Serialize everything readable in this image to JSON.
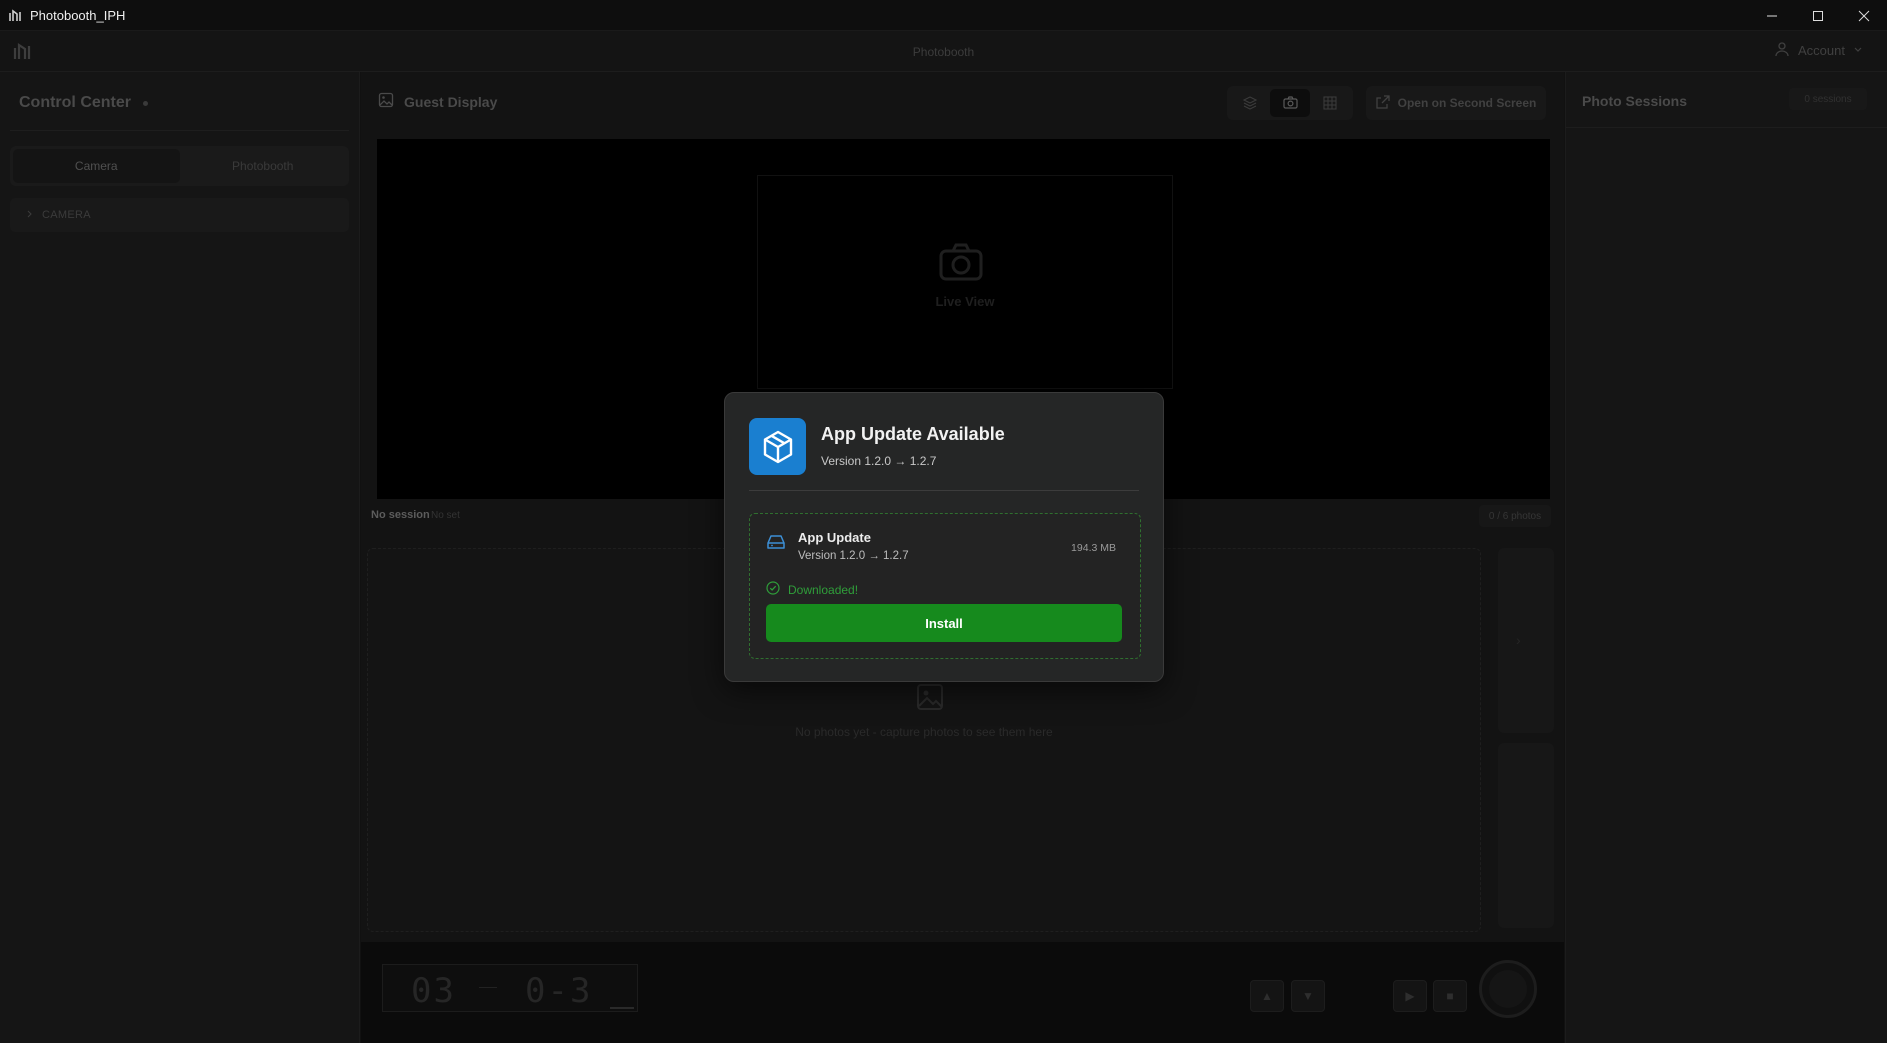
{
  "window": {
    "title": "Photobooth_IPH",
    "controls": [
      "minimize-icon",
      "maximize-icon",
      "close-icon"
    ]
  },
  "header": {
    "center_title": "Photobooth",
    "account_label": "Account"
  },
  "left_panel": {
    "title": "Control Center",
    "tabs": [
      {
        "label": "Camera",
        "active": true
      },
      {
        "label": "Photobooth",
        "active": false
      }
    ],
    "section_label": "CAMERA"
  },
  "center": {
    "guest_display_label": "Guest Display",
    "open_second_screen_label": "Open on Second Screen",
    "live_view_label": "Live View",
    "no_session_label": "No session",
    "no_set_label": "No set",
    "photo_count_label": "0 / 6 photos",
    "empty_photos_text": "No photos yet - capture photos to see them here",
    "timer": {
      "left_digits": "03",
      "right_digits": "0-3"
    }
  },
  "right_panel": {
    "title": "Photo Sessions",
    "count_label": "0 sessions"
  },
  "modal": {
    "title": "App Update Available",
    "version": "Version 1.2.0 → 1.2.7",
    "card": {
      "title": "App Update",
      "version": "Version 1.2.0 → 1.2.7",
      "size": "194.3 MB",
      "status": "Downloaded!",
      "install_label": "Install"
    },
    "colors": {
      "accent_blue": "#1a7fd0",
      "install_green": "#168a1d",
      "status_green": "#2f9e3a"
    }
  }
}
